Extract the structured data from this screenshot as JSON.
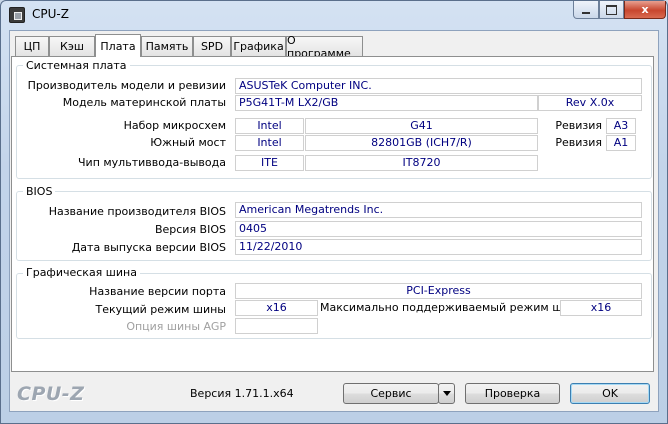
{
  "window": {
    "title": "CPU-Z",
    "minimize_glyph": "",
    "maximize_glyph": "",
    "close_glyph": "x"
  },
  "tabs": [
    {
      "label": "ЦП"
    },
    {
      "label": "Кэш"
    },
    {
      "label": "Плата",
      "active": true
    },
    {
      "label": "Память"
    },
    {
      "label": "SPD"
    },
    {
      "label": "Графика"
    },
    {
      "label": "О программе"
    }
  ],
  "motherboard": {
    "group_label": "Системная плата",
    "manufacturer_label": "Производитель модели и ревизии",
    "manufacturer_value": "ASUSTeK Computer INC.",
    "model_label": "Модель материнской платы",
    "model_value": "P5G41T-M LX2/GB",
    "model_revision": "Rev X.0x",
    "chipset_label": "Набор микросхем",
    "chipset_vendor": "Intel",
    "chipset_name": "G41",
    "chipset_rev_label": "Ревизия",
    "chipset_rev": "A3",
    "southbridge_label": "Южный мост",
    "southbridge_vendor": "Intel",
    "southbridge_name": "82801GB (ICH7/R)",
    "southbridge_rev_label": "Ревизия",
    "southbridge_rev": "A1",
    "lpcio_label": "Чип мультиввода-вывода",
    "lpcio_vendor": "ITE",
    "lpcio_name": "IT8720"
  },
  "bios": {
    "group_label": "BIOS",
    "brand_label": "Название производителя BIOS",
    "brand_value": "American Megatrends Inc.",
    "version_label": "Версия BIOS",
    "version_value": "0405",
    "date_label": "Дата выпуска версии BIOS",
    "date_value": "11/22/2010"
  },
  "graphic_interface": {
    "group_label": "Графическая шина",
    "version_label": "Название версии порта",
    "version_value": "PCI-Express",
    "link_width_label": "Текущий режим шины",
    "link_width_value": "x16",
    "max_supported_label": "Максимально поддерживаемый режим шины",
    "max_supported_value": "x16",
    "side_band_label": "Опция шины AGP",
    "side_band_value": ""
  },
  "footer": {
    "logo": "CPU-Z",
    "version": "Версия 1.71.1.x64",
    "tools_label": "Сервис",
    "validate_label": "Проверка",
    "ok_label": "OK"
  }
}
